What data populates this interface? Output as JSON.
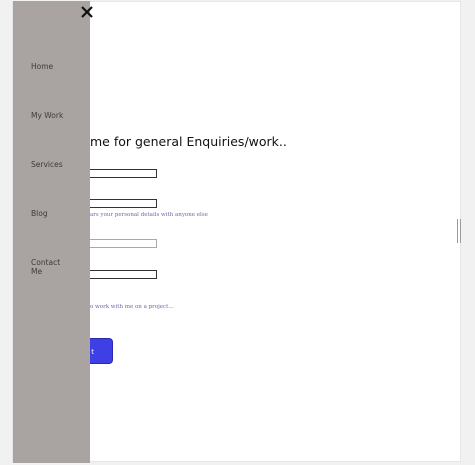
{
  "form": {
    "heading": "me for general Enquiries/work..",
    "privacy_note": "ars your personal details with anyone else",
    "project_note": "o work with me on a project...",
    "submit_label": "t"
  },
  "sidebar": {
    "close_icon": "close-icon",
    "items": [
      {
        "label": "Home"
      },
      {
        "label": "My Work"
      },
      {
        "label": "Services"
      },
      {
        "label": "Blog"
      },
      {
        "label": "Contact Me"
      }
    ]
  },
  "colors": {
    "sidebar_bg": "#a9a4a1",
    "submit_bg": "#3f3fe6",
    "note_text": "#6a6aa8"
  }
}
